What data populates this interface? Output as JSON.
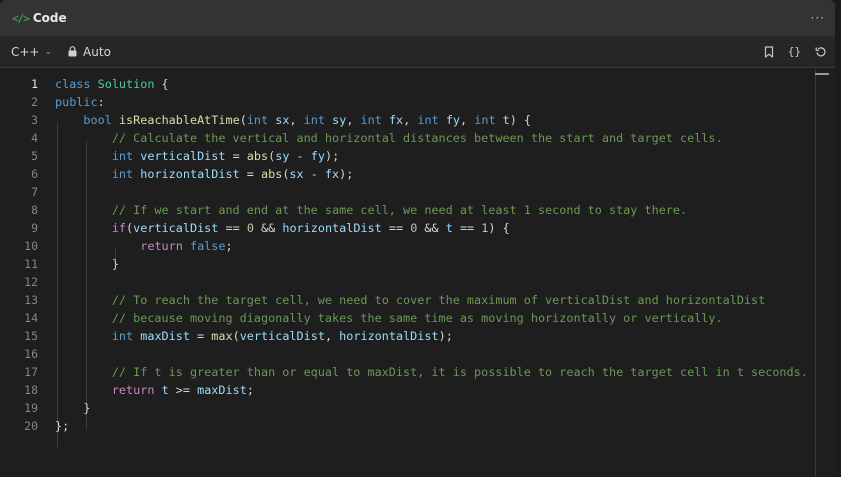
{
  "header": {
    "icon": "code-icon",
    "title": "Code",
    "more": "more-icon"
  },
  "toolbar": {
    "language": "C++",
    "lock_label": "Auto",
    "icons": [
      "bookmark-icon",
      "braces-icon",
      "reset-icon"
    ]
  },
  "editor": {
    "active_line": 1,
    "line_numbers": [
      "1",
      "2",
      "3",
      "4",
      "5",
      "6",
      "7",
      "8",
      "9",
      "10",
      "11",
      "12",
      "13",
      "14",
      "15",
      "16",
      "17",
      "18",
      "19",
      "20"
    ],
    "lines": [
      "class Solution {",
      "public:",
      "    bool isReachableAtTime(int sx, int sy, int fx, int fy, int t) {",
      "        // Calculate the vertical and horizontal distances between the start and target cells.",
      "        int verticalDist = abs(sy - fy);",
      "        int horizontalDist = abs(sx - fx);",
      "",
      "        // If we start and end at the same cell, we need at least 1 second to stay there.",
      "        if(verticalDist == 0 && horizontalDist == 0 && t == 1) {",
      "            return false;",
      "        }",
      "",
      "        // To reach the target cell, we need to cover the maximum of verticalDist and horizontalDist",
      "        // because moving diagonally takes the same time as moving horizontally or vertically.",
      "        int maxDist = max(verticalDist, horizontalDist);",
      "",
      "        // If t is greater than or equal to maxDist, it is possible to reach the target cell in t seconds.",
      "        return t >= maxDist;",
      "    }",
      "};"
    ]
  }
}
